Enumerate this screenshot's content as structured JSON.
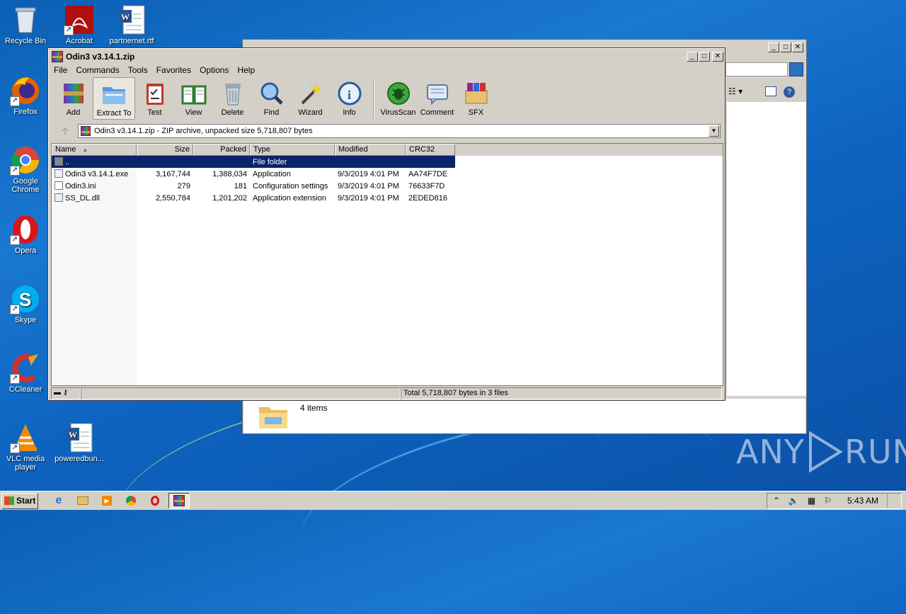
{
  "desktop": {
    "icons": [
      {
        "label": "Recycle Bin",
        "icon": "recycle-bin-icon"
      },
      {
        "label": "Acrobat",
        "icon": "acrobat-icon"
      },
      {
        "label": "partnernet.rtf",
        "icon": "word-doc-icon"
      },
      {
        "label": "Firefox",
        "icon": "firefox-icon"
      },
      {
        "label": "Google Chrome",
        "icon": "chrome-icon"
      },
      {
        "label": "Opera",
        "icon": "opera-icon"
      },
      {
        "label": "Skype",
        "icon": "skype-icon"
      },
      {
        "label": "CCleaner",
        "icon": "ccleaner-icon"
      },
      {
        "label": "VLC media player",
        "icon": "vlc-icon"
      },
      {
        "label": "poweredbun...",
        "icon": "word-doc-icon"
      }
    ]
  },
  "explorer": {
    "status": {
      "count": "4 items"
    }
  },
  "winrar": {
    "title": "Odin3 v3.14.1.zip",
    "menu": [
      "File",
      "Commands",
      "Tools",
      "Favorites",
      "Options",
      "Help"
    ],
    "toolbar": [
      {
        "label": "Add",
        "icon": "add-archive-icon"
      },
      {
        "label": "Extract To",
        "icon": "extract-folder-icon"
      },
      {
        "label": "Test",
        "icon": "test-clipboard-icon"
      },
      {
        "label": "View",
        "icon": "view-book-icon"
      },
      {
        "label": "Delete",
        "icon": "trash-can-icon"
      },
      {
        "label": "Find",
        "icon": "magnifier-icon"
      },
      {
        "label": "Wizard",
        "icon": "magic-wand-icon"
      },
      {
        "label": "Info",
        "icon": "info-icon"
      },
      {
        "label": "VirusScan",
        "icon": "virus-scan-icon"
      },
      {
        "label": "Comment",
        "icon": "comment-icon"
      },
      {
        "label": "SFX",
        "icon": "sfx-box-icon"
      }
    ],
    "path": "Odin3 v3.14.1.zip - ZIP archive, unpacked size 5,718,807 bytes",
    "columns": [
      "Name",
      "Size",
      "Packed",
      "Type",
      "Modified",
      "CRC32"
    ],
    "rows": [
      {
        "name": "..",
        "size": "",
        "packed": "",
        "type": "File folder",
        "modified": "",
        "crc": "",
        "selected": true
      },
      {
        "name": "Odin3 v3.14.1.exe",
        "size": "3,167,744",
        "packed": "1,388,034",
        "type": "Application",
        "modified": "9/3/2019 4:01 PM",
        "crc": "AA74F7DE"
      },
      {
        "name": "Odin3.ini",
        "size": "279",
        "packed": "181",
        "type": "Configuration settings",
        "modified": "9/3/2019 4:01 PM",
        "crc": "76633F7D"
      },
      {
        "name": "SS_DL.dll",
        "size": "2,550,784",
        "packed": "1,201,202",
        "type": "Application extension",
        "modified": "9/3/2019 4:01 PM",
        "crc": "2EDED816"
      }
    ],
    "status_total": "Total 5,718,807 bytes in 3 files"
  },
  "watermark": {
    "left": "ANY",
    "right": "RUN"
  },
  "taskbar": {
    "start_label": "Start",
    "clock": "5:43 AM"
  }
}
